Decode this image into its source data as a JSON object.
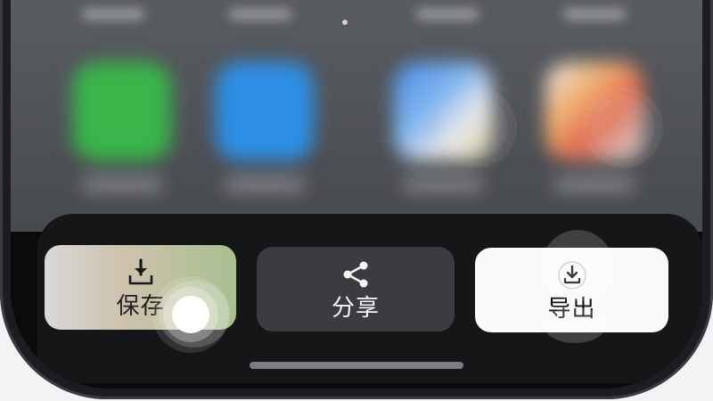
{
  "actions": [
    {
      "id": "save",
      "label": "保存",
      "icon": "download-tray-icon"
    },
    {
      "id": "share",
      "label": "分享",
      "icon": "share-icon"
    },
    {
      "id": "export",
      "label": "导出",
      "icon": "circle-download-icon"
    }
  ],
  "colors": {
    "sheet_background": "#151617",
    "share_button": "#3a3c40",
    "export_button": "#fafafa",
    "touch_indicator": "#ffffff"
  }
}
